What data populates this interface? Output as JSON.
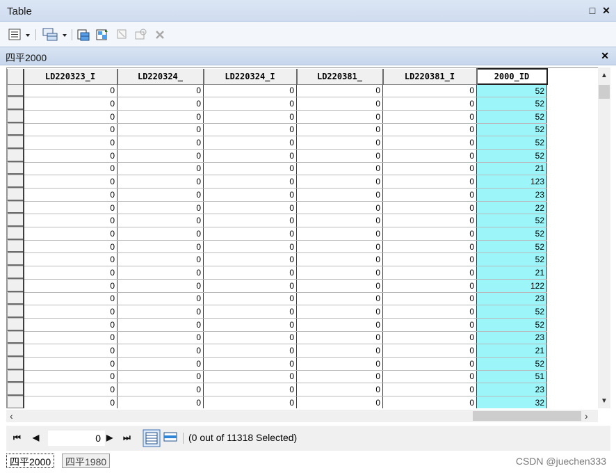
{
  "window": {
    "title": "Table"
  },
  "table_tab": {
    "title": "四平2000"
  },
  "columns": [
    "LD220323_I",
    "LD220324_",
    "LD220324_I",
    "LD220381_",
    "LD220381_I",
    "2000_ID"
  ],
  "rows": [
    [
      "0",
      "0",
      "0",
      "0",
      "0",
      "52"
    ],
    [
      "0",
      "0",
      "0",
      "0",
      "0",
      "52"
    ],
    [
      "0",
      "0",
      "0",
      "0",
      "0",
      "52"
    ],
    [
      "0",
      "0",
      "0",
      "0",
      "0",
      "52"
    ],
    [
      "0",
      "0",
      "0",
      "0",
      "0",
      "52"
    ],
    [
      "0",
      "0",
      "0",
      "0",
      "0",
      "52"
    ],
    [
      "0",
      "0",
      "0",
      "0",
      "0",
      "21"
    ],
    [
      "0",
      "0",
      "0",
      "0",
      "0",
      "123"
    ],
    [
      "0",
      "0",
      "0",
      "0",
      "0",
      "23"
    ],
    [
      "0",
      "0",
      "0",
      "0",
      "0",
      "22"
    ],
    [
      "0",
      "0",
      "0",
      "0",
      "0",
      "52"
    ],
    [
      "0",
      "0",
      "0",
      "0",
      "0",
      "52"
    ],
    [
      "0",
      "0",
      "0",
      "0",
      "0",
      "52"
    ],
    [
      "0",
      "0",
      "0",
      "0",
      "0",
      "52"
    ],
    [
      "0",
      "0",
      "0",
      "0",
      "0",
      "21"
    ],
    [
      "0",
      "0",
      "0",
      "0",
      "0",
      "122"
    ],
    [
      "0",
      "0",
      "0",
      "0",
      "0",
      "23"
    ],
    [
      "0",
      "0",
      "0",
      "0",
      "0",
      "52"
    ],
    [
      "0",
      "0",
      "0",
      "0",
      "0",
      "52"
    ],
    [
      "0",
      "0",
      "0",
      "0",
      "0",
      "23"
    ],
    [
      "0",
      "0",
      "0",
      "0",
      "0",
      "21"
    ],
    [
      "0",
      "0",
      "0",
      "0",
      "0",
      "52"
    ],
    [
      "0",
      "0",
      "0",
      "0",
      "0",
      "51"
    ],
    [
      "0",
      "0",
      "0",
      "0",
      "0",
      "23"
    ],
    [
      "0",
      "0",
      "0",
      "0",
      "0",
      "32"
    ]
  ],
  "navigation": {
    "current_record": "0",
    "status": "(0 out of 11318 Selected)"
  },
  "bottom_tabs": [
    "四平2000",
    "四平1980"
  ],
  "watermark": "CSDN @juechen333",
  "colors": {
    "highlight_column": "#9cf5f8",
    "title_bar": "#d3dff0"
  }
}
